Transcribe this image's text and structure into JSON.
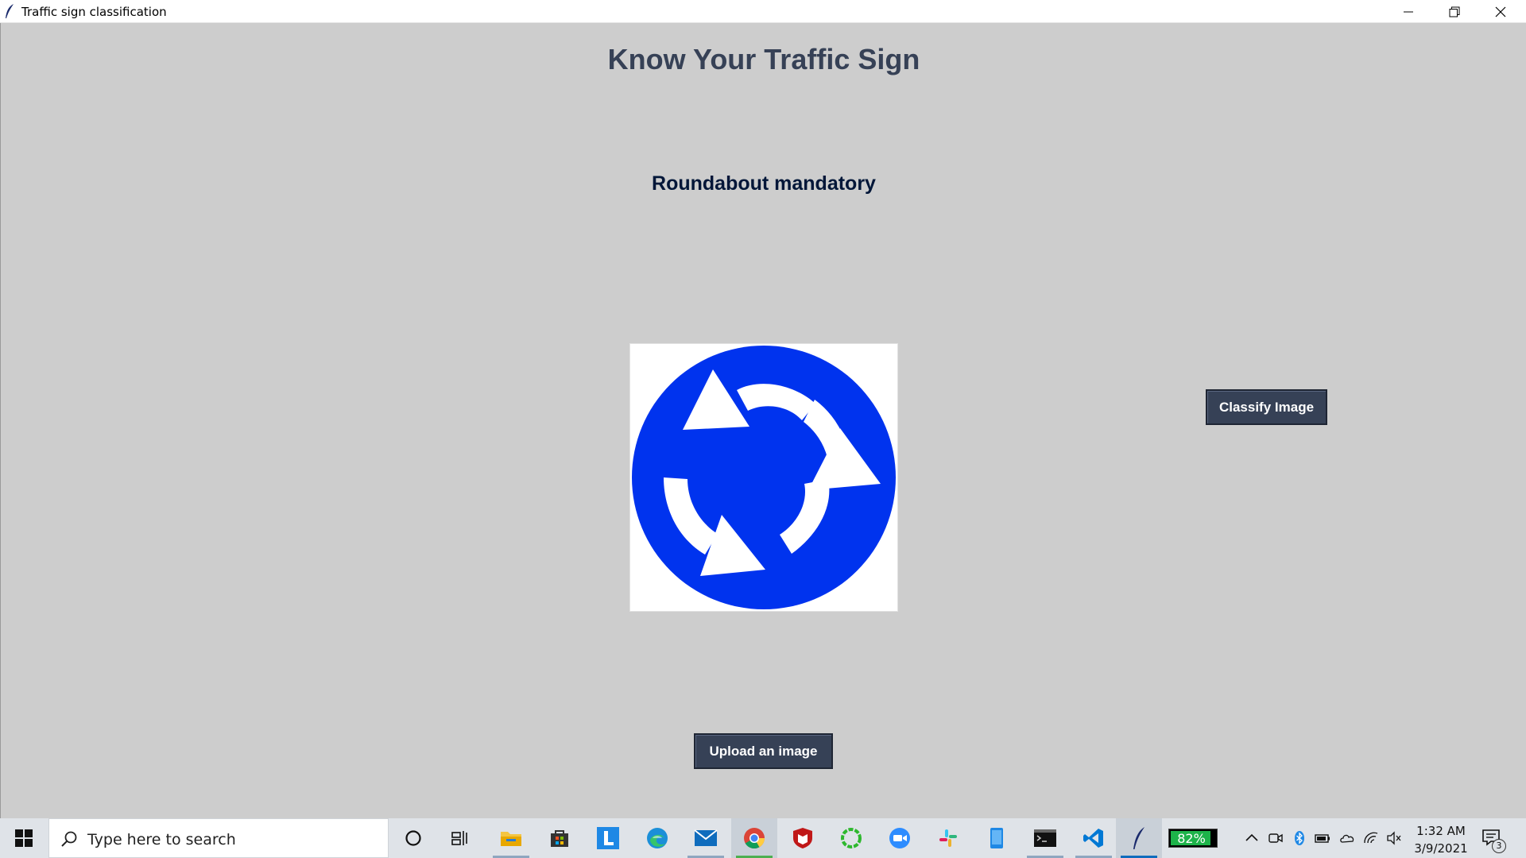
{
  "window": {
    "title": "Traffic sign classification",
    "controls": [
      "minimize",
      "restore",
      "close"
    ]
  },
  "app": {
    "heading": "Know Your Traffic Sign",
    "result": "Roundabout mandatory",
    "classify_button": "Classify Image",
    "upload_button": "Upload an image",
    "image": {
      "icon": "roundabout-sign-icon",
      "colors": {
        "sign": "#0033ee",
        "arrows": "#ffffff"
      }
    }
  },
  "taskbar": {
    "search_placeholder": "Type here to search",
    "apps": [
      "cortana-icon",
      "task-view-icon",
      "file-explorer-icon",
      "microsoft-store-icon",
      "l-app-icon",
      "edge-icon",
      "mail-icon",
      "chrome-icon",
      "mcafee-icon",
      "ring-app-icon",
      "zoom-icon",
      "slack-icon",
      "phone-app-icon",
      "terminal-icon",
      "vscode-icon",
      "python-feather-icon"
    ],
    "battery_percent": "82%",
    "tray": [
      "chevron-up-icon",
      "meet-now-icon",
      "bluetooth-icon",
      "battery-icon",
      "onedrive-icon",
      "wifi-icon",
      "volume-muted-icon"
    ],
    "time": "1:32 AM",
    "date": "3/9/2021",
    "notification_count": "3"
  },
  "colors": {
    "background": "#cdcdcd",
    "heading": "#364156",
    "result": "#011638",
    "button": "#364156",
    "button_text": "#ffffff"
  }
}
